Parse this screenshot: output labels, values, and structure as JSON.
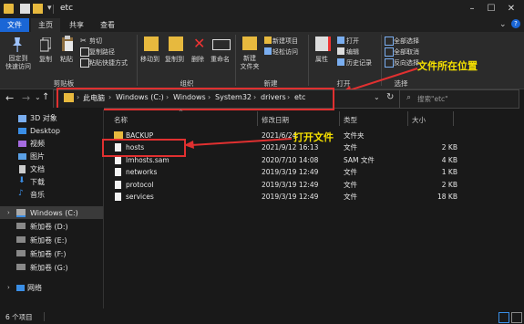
{
  "window": {
    "title": "etc"
  },
  "tabs": [
    "文件",
    "主页",
    "共享",
    "查看"
  ],
  "ribbon": {
    "clipboard": {
      "pin": "固定到\n快速访问",
      "copy": "复制",
      "paste": "粘贴",
      "cut": "剪切",
      "copy_path": "复制路径",
      "paste_shortcut": "粘贴快捷方式",
      "group": "剪贴板"
    },
    "organize": {
      "move_to": "移动到",
      "copy_to": "复制到",
      "delete": "删除",
      "rename": "重命名",
      "group": "组织"
    },
    "new": {
      "new_folder": "新建\n文件夹",
      "new_item": "新建项目",
      "easy_access": "轻松访问",
      "group": "新建"
    },
    "open": {
      "properties": "属性",
      "open": "打开",
      "edit": "编辑",
      "history": "历史记录",
      "group": "打开"
    },
    "select": {
      "select_all": "全部选择",
      "select_none": "全部取消",
      "invert": "反向选择",
      "group": "选择"
    }
  },
  "address": {
    "crumbs": [
      "此电脑",
      "Windows (C:)",
      "Windows",
      "System32",
      "drivers",
      "etc"
    ],
    "search_placeholder": "搜索\"etc\""
  },
  "nav": {
    "items": [
      "3D 对象",
      "Desktop",
      "视频",
      "图片",
      "文档",
      "下载",
      "音乐",
      "Windows (C:)",
      "新加卷 (D:)",
      "新加卷 (E:)",
      "新加卷 (F:)",
      "新加卷 (G:)",
      "网络"
    ]
  },
  "columns": {
    "name": "名称",
    "date": "修改日期",
    "type": "类型",
    "size": "大小"
  },
  "files": [
    {
      "name": "BACKUP",
      "date": "2021/6/24",
      "type": "文件夹",
      "size": ""
    },
    {
      "name": "hosts",
      "date": "2021/9/12 16:13",
      "type": "文件",
      "size": "2 KB"
    },
    {
      "name": "lmhosts.sam",
      "date": "2020/7/10 14:08",
      "type": "SAM 文件",
      "size": "4 KB"
    },
    {
      "name": "networks",
      "date": "2019/3/19 12:49",
      "type": "文件",
      "size": "1 KB"
    },
    {
      "name": "protocol",
      "date": "2019/3/19 12:49",
      "type": "文件",
      "size": "2 KB"
    },
    {
      "name": "services",
      "date": "2019/3/19 12:49",
      "type": "文件",
      "size": "18 KB"
    }
  ],
  "annotations": {
    "location": "文件所在位置",
    "open_file": "打开文件"
  },
  "status": {
    "count": "6 个项目"
  },
  "colors": {
    "annotation": "#f5e000",
    "highlight_box": "#e03030",
    "accent": "#1a66d6"
  }
}
